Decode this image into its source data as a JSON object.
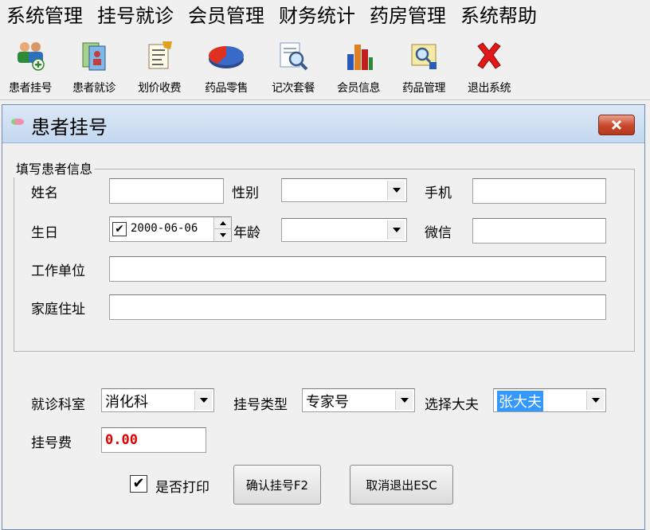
{
  "menubar": {
    "items": [
      "系统管理",
      "挂号就诊",
      "会员管理",
      "财务统计",
      "药房管理",
      "系统帮助"
    ]
  },
  "toolbar": {
    "items": [
      {
        "label": "患者挂号",
        "icon": "users-register-icon"
      },
      {
        "label": "患者就诊",
        "icon": "patient-visit-icon"
      },
      {
        "label": "划价收费",
        "icon": "billing-icon"
      },
      {
        "label": "药品零售",
        "icon": "pie-chart-icon"
      },
      {
        "label": "记次套餐",
        "icon": "magnifier-document-icon"
      },
      {
        "label": "会员信息",
        "icon": "bar-chart-icon"
      },
      {
        "label": "药品管理",
        "icon": "drug-management-icon"
      },
      {
        "label": "退出系统",
        "icon": "close-x-icon"
      }
    ]
  },
  "dialog": {
    "title": "患者挂号",
    "group_title": "填写患者信息",
    "labels": {
      "name": "姓名",
      "gender": "性别",
      "phone": "手机",
      "birthday": "生日",
      "age": "年龄",
      "wechat": "微信",
      "workplace": "工作单位",
      "address": "家庭住址",
      "department": "就诊科室",
      "reg_type": "挂号类型",
      "doctor": "选择大夫",
      "fee": "挂号费",
      "print": "是否打印"
    },
    "values": {
      "name": "",
      "gender": "",
      "phone": "",
      "birthday": "2000-06-06",
      "birthday_checked": "✔",
      "age": "",
      "wechat": "",
      "workplace": "",
      "address": "",
      "department": "消化科",
      "reg_type": "专家号",
      "doctor": "张大夫",
      "fee": "0.00",
      "print_checked": "✔"
    },
    "buttons": {
      "confirm": "确认挂号F2",
      "cancel": "取消退出ESC"
    }
  },
  "colors": {
    "fee_text": "#e00000",
    "selection": "#3399ff",
    "close_button": "#c8462a"
  }
}
